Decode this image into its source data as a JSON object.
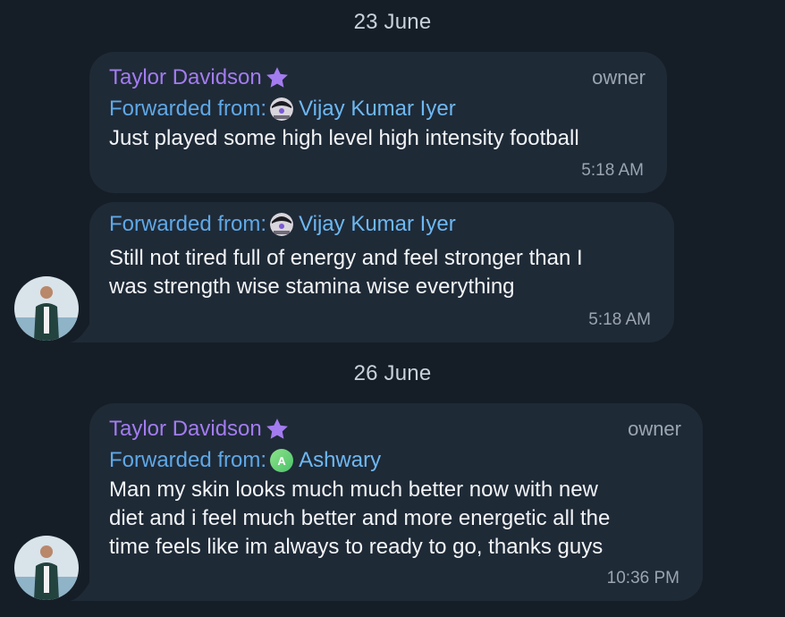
{
  "chat": {
    "date_1": "23 June",
    "date_2": "26 June",
    "messages": [
      {
        "sender": "Taylor Davidson",
        "role": "owner",
        "forward_label": "Forwarded from:",
        "forward_name": "Vijay Kumar Iyer",
        "text": "Just played some high level high intensity football",
        "time": "5:18 AM"
      },
      {
        "forward_label": "Forwarded from:",
        "forward_name": "Vijay Kumar Iyer",
        "text_line1": "Still not tired full of energy and feel stronger than I",
        "text_line2": "was strength wise stamina wise everything",
        "time": "5:18 AM"
      },
      {
        "sender": "Taylor Davidson",
        "role": "owner",
        "forward_label": "Forwarded from:",
        "forward_name": "Ashwary",
        "forward_initial": "A",
        "text_line1": "Man my skin looks much much better now with new",
        "text_line2": "diet and i feel much better and more energetic all the",
        "text_line3": "time feels like im always to ready to go, thanks guys",
        "time": "10:36 PM"
      }
    ]
  },
  "colors": {
    "background": "#151e27",
    "bubble": "#1f2a37",
    "sender_name": "#a37cf0",
    "forward_link": "#6db8f2",
    "meta_text": "#9aa5b1"
  },
  "icons": {
    "admin_badge": "star-icon",
    "sender_avatar": "user-avatar"
  }
}
